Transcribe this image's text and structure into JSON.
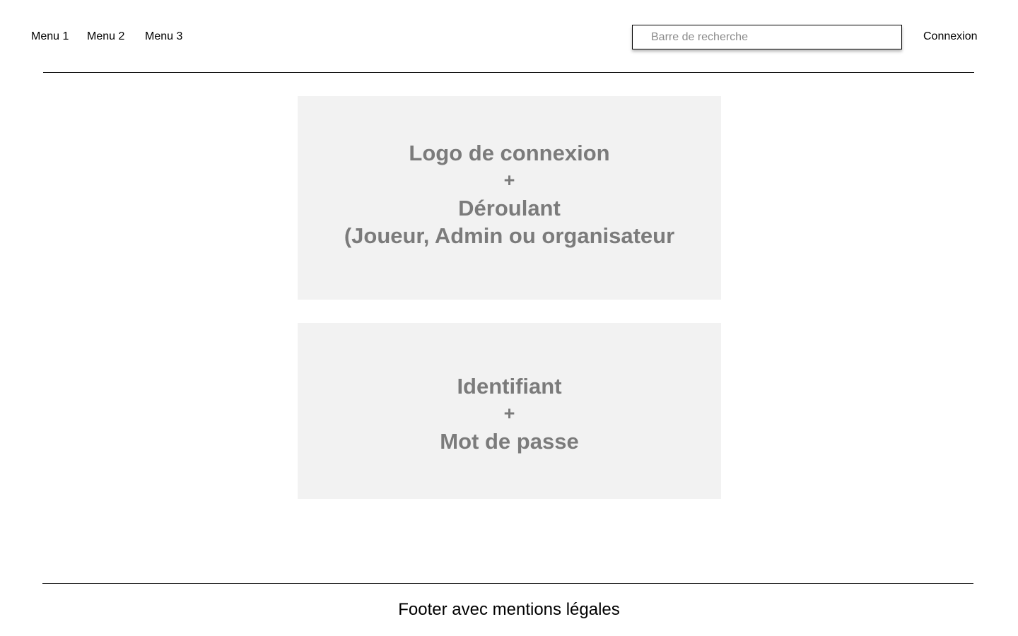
{
  "header": {
    "menus": [
      "Menu 1",
      "Menu 2",
      "Menu 3"
    ],
    "search": {
      "placeholder": "Barre de recherche",
      "value": ""
    },
    "login_label": "Connexion"
  },
  "main": {
    "login_block": {
      "line1": "Logo de connexion",
      "plus": "+",
      "line2": "Déroulant",
      "line3": "(Joueur, Admin ou organisateur"
    },
    "credentials_block": {
      "line1": "Identifiant",
      "plus": "+",
      "line2": "Mot de passe"
    }
  },
  "footer": {
    "text": "Footer avec mentions légales"
  },
  "colors": {
    "block_background": "#f2f2f2",
    "block_text": "#7b7b7b",
    "divider": "#000000"
  }
}
